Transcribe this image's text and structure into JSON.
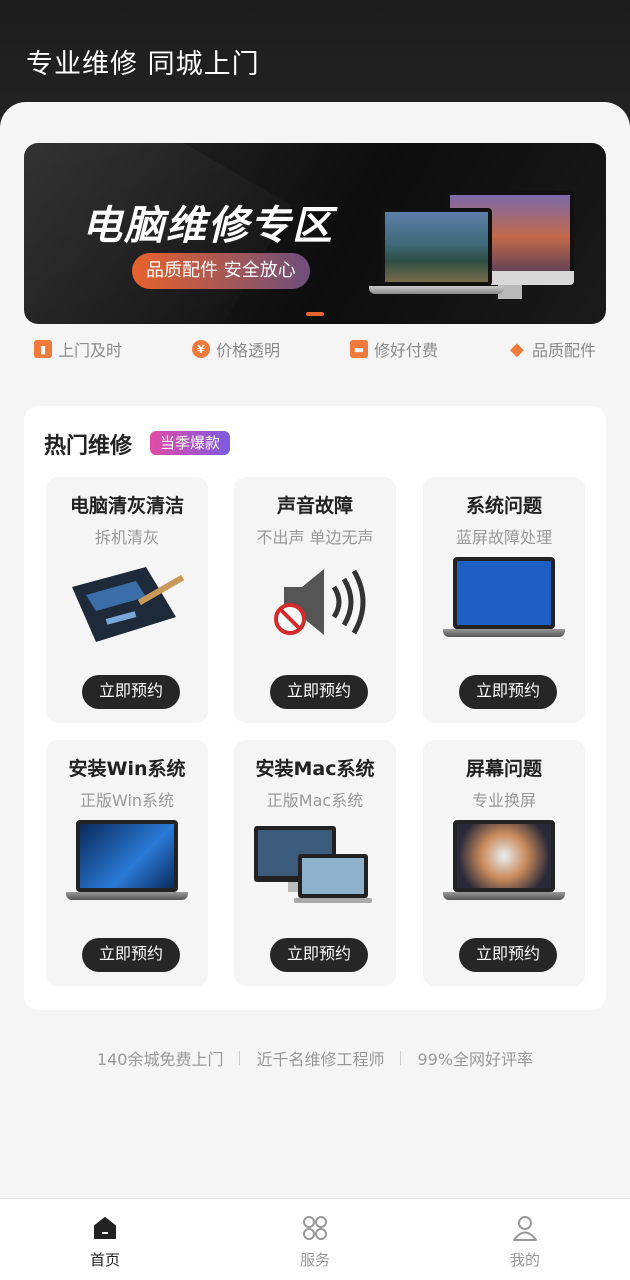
{
  "header": {
    "title": "专业维修 同城上门"
  },
  "banner": {
    "title": "电脑维修专区",
    "pill": "品质配件 安全放心"
  },
  "features": [
    {
      "label": "上门及时",
      "icon": "door-icon"
    },
    {
      "label": "价格透明",
      "icon": "yen-icon"
    },
    {
      "label": "修好付费",
      "icon": "card-icon"
    },
    {
      "label": "品质配件",
      "icon": "diamond-icon"
    }
  ],
  "hot": {
    "title": "热门维修",
    "badge": "当季爆款",
    "tiles": [
      {
        "title": "电脑清灰清洁",
        "sub": "拆机清灰",
        "button": "立即预约"
      },
      {
        "title": "声音故障",
        "sub": "不出声 单边无声",
        "button": "立即预约"
      },
      {
        "title": "系统问题",
        "sub": "蓝屏故障处理",
        "button": "立即预约"
      },
      {
        "title": "安装Win系统",
        "sub": "正版Win系统",
        "button": "立即预约"
      },
      {
        "title": "安装Mac系统",
        "sub": "正版Mac系统",
        "button": "立即预约"
      },
      {
        "title": "屏幕问题",
        "sub": "专业换屏",
        "button": "立即预约"
      }
    ]
  },
  "stats": [
    "140余城免费上门",
    "近千名维修工程师",
    "99%全网好评率"
  ],
  "tabs": [
    {
      "label": "首页",
      "active": true
    },
    {
      "label": "服务",
      "active": false
    },
    {
      "label": "我的",
      "active": false
    }
  ],
  "colors": {
    "accent": "#e8622c",
    "dark": "#262626"
  }
}
